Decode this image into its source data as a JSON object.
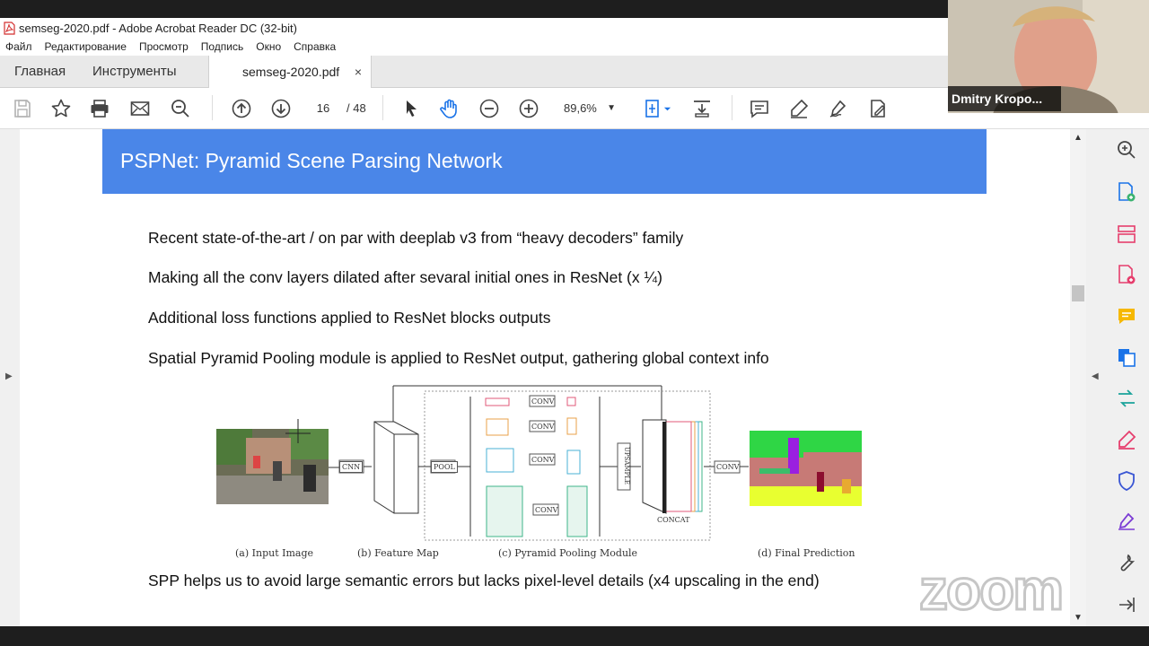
{
  "window": {
    "title": "semseg-2020.pdf - Adobe Acrobat Reader DC (32-bit)"
  },
  "menu": [
    "Файл",
    "Редактирование",
    "Просмотр",
    "Подпись",
    "Окно",
    "Справка"
  ],
  "tabs": {
    "home": "Главная",
    "tools": "Инструменты",
    "document": "semseg-2020.pdf",
    "close": "×"
  },
  "toolbar": {
    "page_current": "16",
    "page_total": "/ 48",
    "zoom": "89,6%"
  },
  "slide": {
    "title": "PSPNet: Pyramid Scene Parsing Network",
    "bullets": [
      "Recent state-of-the-art / on par with deeplab v3 from “heavy decoders” family",
      "Making all the conv layers dilated after sevaral initial ones in ResNet (x ¼)",
      "Additional loss functions applied to ResNet blocks outputs",
      "Spatial Pyramid Pooling module is applied to ResNet output, gathering global context info",
      "SPP helps us to avoid large semantic errors but lacks pixel-level details (x4 upscaling in the end)"
    ]
  },
  "figure": {
    "captions": [
      "(a) Input Image",
      "(b) Feature Map",
      "(c) Pyramid Pooling Module",
      "(d) Final Prediction"
    ],
    "blocks": {
      "cnn": "CNN",
      "pool": "POOL",
      "conv": "CONV",
      "upsample": "UPSAMPLE",
      "concat": "CONCAT"
    }
  },
  "video": {
    "name": "Dmitry Kropo..."
  },
  "watermark": "zoom",
  "colors": {
    "slide_header": "#4a86e8",
    "acrobat_red": "#d32f2f",
    "panel_icon_blue": "#1a73e8",
    "panel_icon_pink": "#e63e6d"
  }
}
